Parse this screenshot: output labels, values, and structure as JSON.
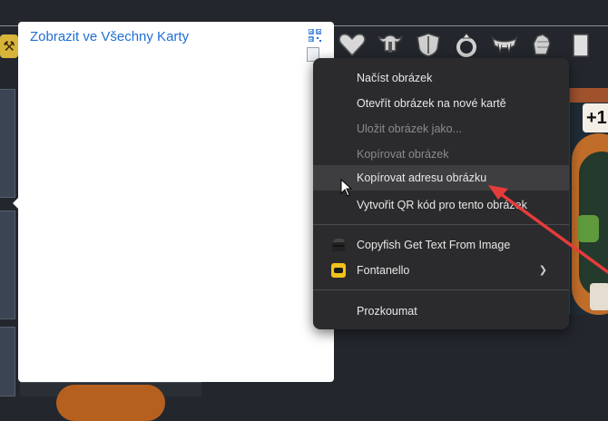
{
  "preview": {
    "link_text": "Zobrazit ve Všechny Karty"
  },
  "context_menu": {
    "items": [
      {
        "label": "Načíst obrázek",
        "enabled": true
      },
      {
        "label": "Otevřít obrázek na nové kartě",
        "enabled": true
      },
      {
        "label": "Uložit obrázek jako...",
        "enabled": false
      },
      {
        "label": "Kopírovat obrázek",
        "enabled": false
      },
      {
        "label": "Kopírovat adresu obrázku",
        "enabled": true,
        "hovered": true
      },
      {
        "label": "Vytvořit QR kód pro tento obrázek",
        "enabled": true
      }
    ],
    "extensions": [
      {
        "label": "Copyfish Get Text From Image",
        "icon": "copyfish-icon"
      },
      {
        "label": "Fontanello",
        "icon": "fontanello-icon",
        "submenu": true
      }
    ],
    "inspect_label": "Prozkoumat"
  },
  "game": {
    "card_value": "+1"
  },
  "annotation": {
    "arrow_color": "#e63b3b"
  }
}
